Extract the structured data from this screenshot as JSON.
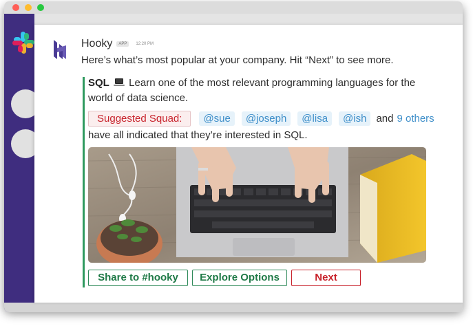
{
  "app": {
    "name": "Hooky",
    "badge": "APP",
    "timestamp": "12:20 PM"
  },
  "message": {
    "intro": "Here’s what’s most popular at your company. Hit “Next” to see more.",
    "topic": "SQL",
    "topic_icon": "laptop-icon",
    "description": " Learn one of the most relevant programming languages for the world of data science.",
    "squad_label": "Suggested Squad:",
    "mentions": [
      "@sue",
      "@joseph",
      "@lisa",
      "@ish"
    ],
    "and_text": "and",
    "others_link": "9 others",
    "followup": "have all indicated that they’re interested in SQL."
  },
  "buttons": {
    "share": "Share to #hooky",
    "explore": "Explore Options",
    "next": "Next"
  },
  "colors": {
    "sidebar": "#3f2d7f",
    "accent_green": "#2f9a5f",
    "accent_red": "#c8232c",
    "mention_blue": "#3d8ec9"
  }
}
